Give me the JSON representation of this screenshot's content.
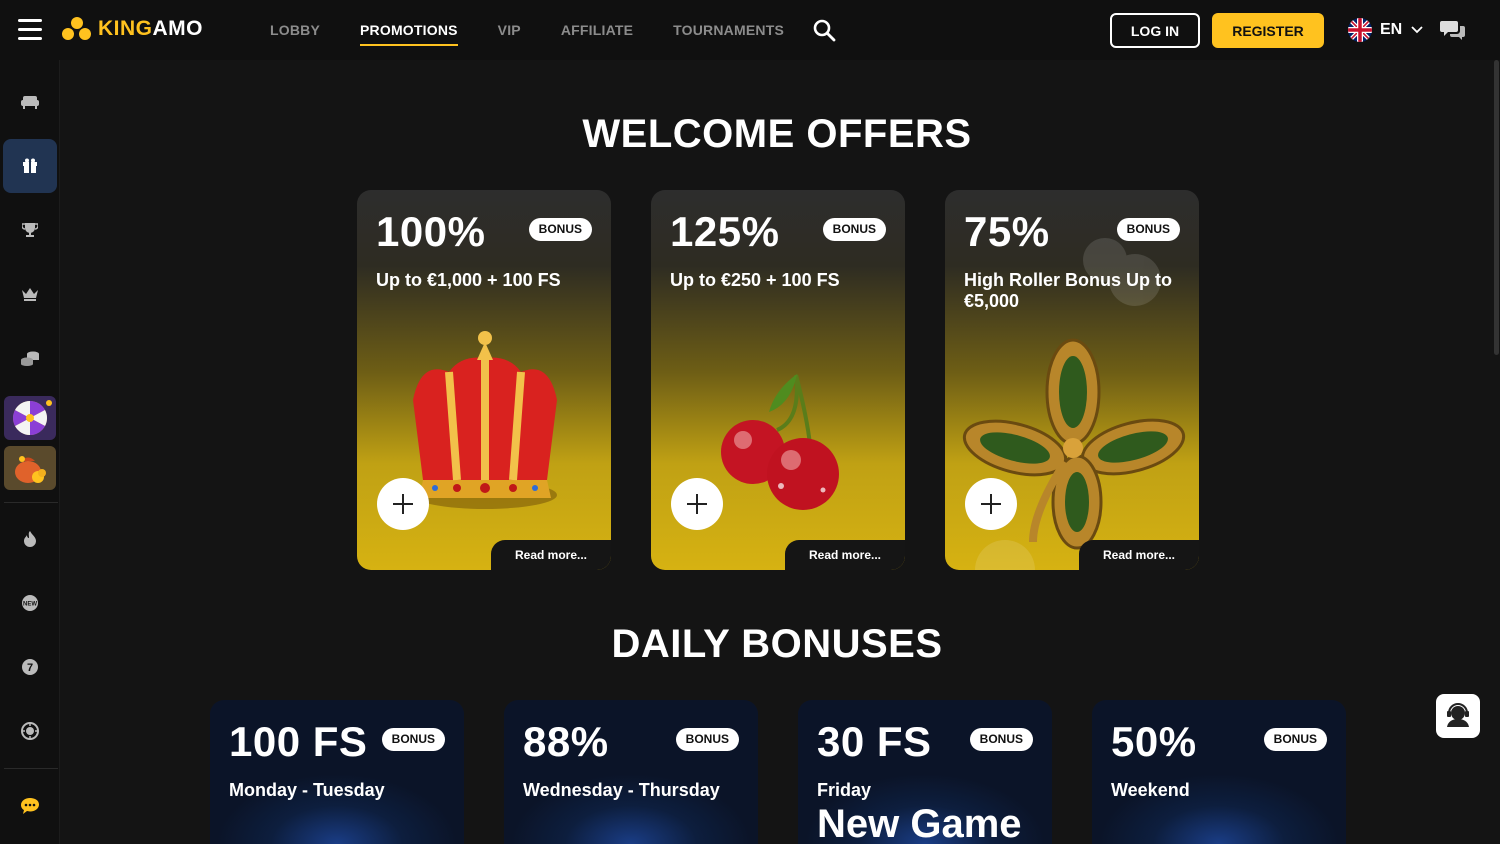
{
  "brand": {
    "name_prefix": "KING",
    "name_suffix": "AMO",
    "accent": "#ffc21f"
  },
  "nav": [
    {
      "label": "LOBBY",
      "active": false
    },
    {
      "label": "PROMOTIONS",
      "active": true
    },
    {
      "label": "VIP",
      "active": false
    },
    {
      "label": "AFFILIATE",
      "active": false
    },
    {
      "label": "TOURNAMENTS",
      "active": false
    }
  ],
  "header": {
    "login_label": "LOG IN",
    "register_label": "REGISTER",
    "language": "EN"
  },
  "sidebar": {
    "items": [
      "sofa-icon",
      "gift-icon",
      "trophy-icon",
      "crown-icon",
      "coins-icon",
      "wheel-of-fortune",
      "treasure-bag",
      "fire-icon",
      "new-icon",
      "seven-icon",
      "roulette-icon",
      "chat-icon"
    ],
    "active": "gift-icon"
  },
  "welcome": {
    "title": "WELCOME OFFERS",
    "cards": [
      {
        "percent": "100%",
        "badge": "BONUS",
        "desc": "Up to €1,000 + 100 FS",
        "more": "Read more...",
        "art": "crown"
      },
      {
        "percent": "125%",
        "badge": "BONUS",
        "desc": "Up to €250 + 100 FS",
        "more": "Read more...",
        "art": "cherries"
      },
      {
        "percent": "75%",
        "badge": "BONUS",
        "desc": "High Roller Bonus Up to €5,000",
        "more": "Read more...",
        "art": "clover"
      }
    ]
  },
  "daily": {
    "title": "DAILY BONUSES",
    "cards": [
      {
        "percent": "100 FS",
        "badge": "BONUS",
        "desc": "Monday - Tuesday"
      },
      {
        "percent": "88%",
        "badge": "BONUS",
        "desc": "Wednesday - Thursday"
      },
      {
        "percent": "30 FS",
        "badge": "BONUS",
        "desc": "Friday",
        "extra": "New Game"
      },
      {
        "percent": "50%",
        "badge": "BONUS",
        "desc": "Weekend"
      }
    ]
  }
}
